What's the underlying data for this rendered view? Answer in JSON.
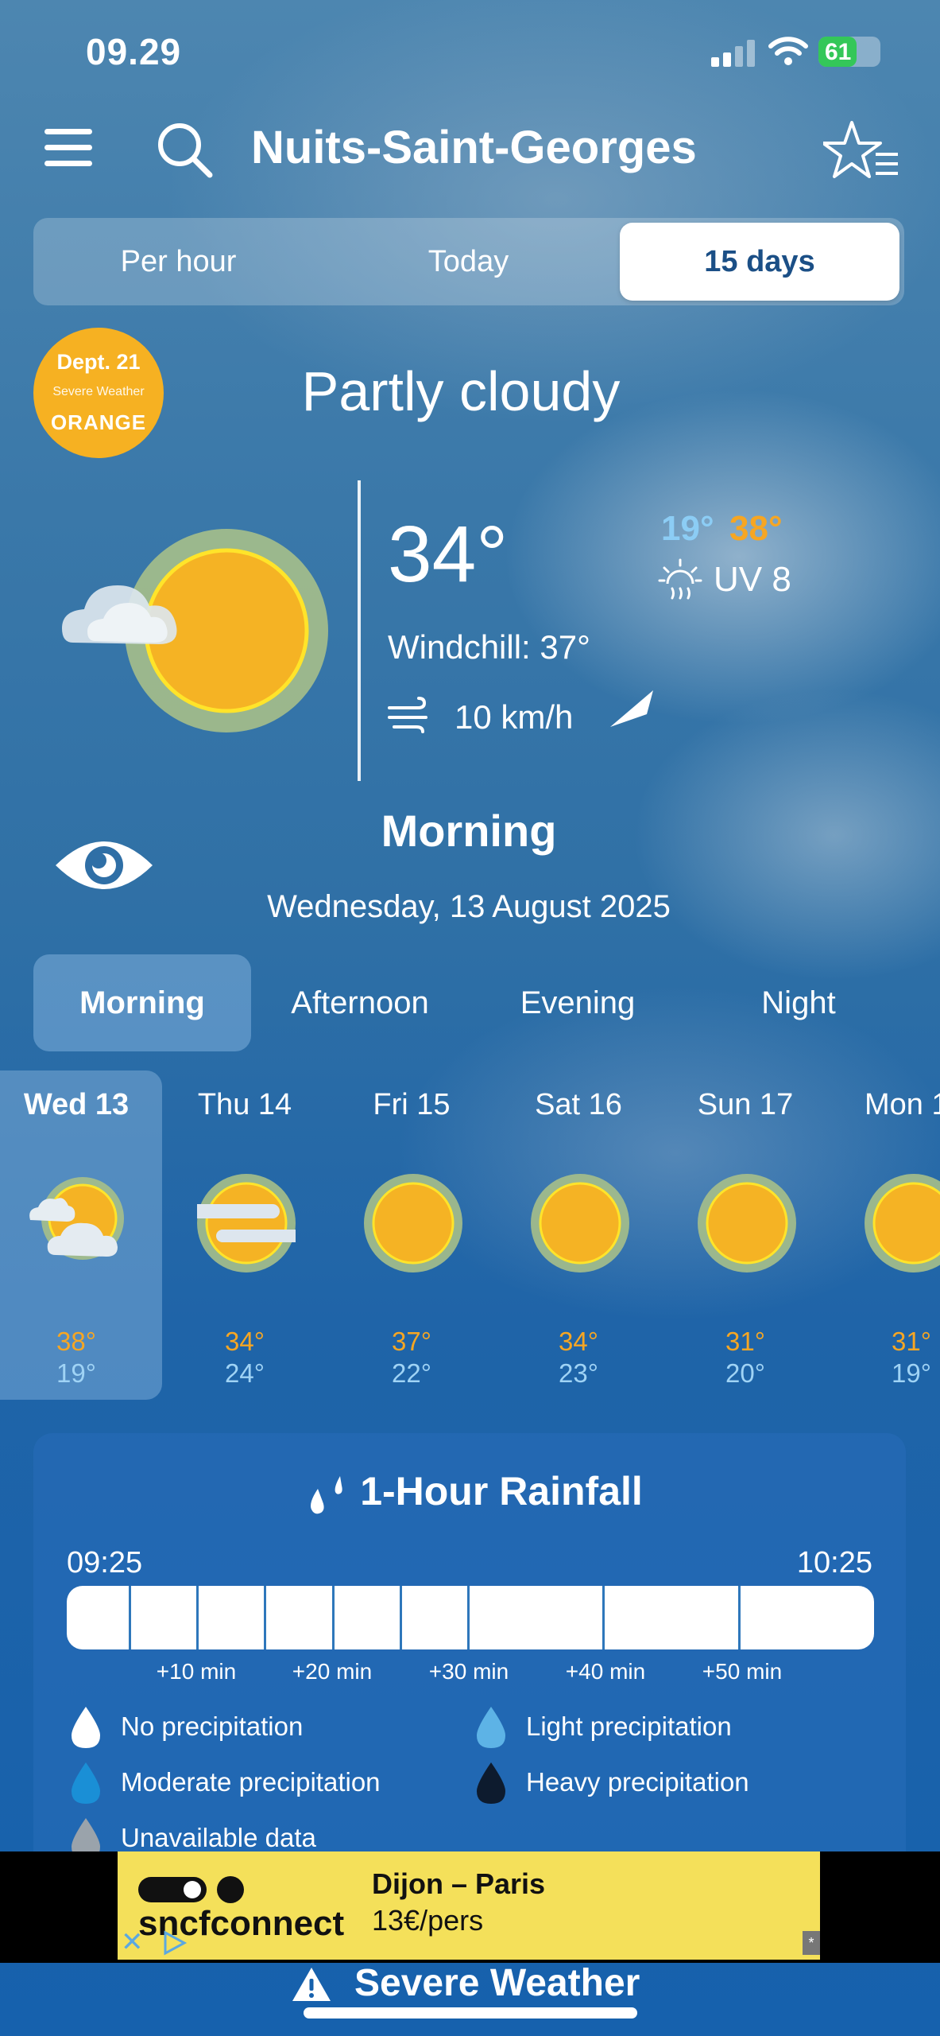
{
  "status_bar": {
    "time": "09.29",
    "battery": "61",
    "battery_level": 0.61
  },
  "header": {
    "city": "Nuits-Saint-Georges"
  },
  "view_tabs": [
    {
      "label": "Per hour"
    },
    {
      "label": "Today"
    },
    {
      "label": "15 days",
      "selected": true
    }
  ],
  "alert": {
    "dept": "Dept. 21",
    "subtitle": "Severe Weather",
    "level": "ORANGE",
    "color": "#f6b122"
  },
  "current": {
    "condition": "Partly cloudy",
    "temperature": "34°",
    "min": "19°",
    "max": "38°",
    "uv": "UV 8",
    "windchill": "Windchill: 37°",
    "wind_speed": "10 km/h",
    "icon": "partly-cloudy-sun-icon"
  },
  "period": {
    "title": "Morning",
    "date": "Wednesday, 13 August 2025"
  },
  "period_tabs": [
    {
      "label": "Morning",
      "selected": true
    },
    {
      "label": "Afternoon"
    },
    {
      "label": "Evening"
    },
    {
      "label": "Night"
    }
  ],
  "days": [
    {
      "label": "Wed 13",
      "max": "38°",
      "min": "19°",
      "icon": "sun-cloud-icon",
      "selected": true
    },
    {
      "label": "Thu 14",
      "max": "34°",
      "min": "24°",
      "icon": "sun-haze-icon"
    },
    {
      "label": "Fri 15",
      "max": "37°",
      "min": "22°",
      "icon": "sun-icon"
    },
    {
      "label": "Sat 16",
      "max": "34°",
      "min": "23°",
      "icon": "sun-icon"
    },
    {
      "label": "Sun 17",
      "max": "31°",
      "min": "20°",
      "icon": "sun-icon"
    },
    {
      "label": "Mon 1",
      "max": "31°",
      "min": "19°",
      "icon": "sun-icon"
    }
  ],
  "rainfall": {
    "title": "1-Hour Rainfall",
    "start": "09:25",
    "end": "10:25",
    "ticks": [
      "+10 min",
      "+20 min",
      "+30 min",
      "+40 min",
      "+50 min"
    ],
    "legend": [
      {
        "label": "No precipitation",
        "color": "#ffffff"
      },
      {
        "label": "Light precipitation",
        "color": "#5db3e6"
      },
      {
        "label": "Moderate precipitation",
        "color": "#1a8fd6"
      },
      {
        "label": "Heavy precipitation",
        "color": "#0d1b2e"
      },
      {
        "label": "Unavailable data",
        "color": "#9aa3ab"
      }
    ]
  },
  "ad": {
    "brand": "sncfconnect",
    "route": "Dijon – Paris",
    "price": "13€/pers",
    "bg": "#f4e05a"
  },
  "footer": {
    "severe": "Severe Weather"
  }
}
